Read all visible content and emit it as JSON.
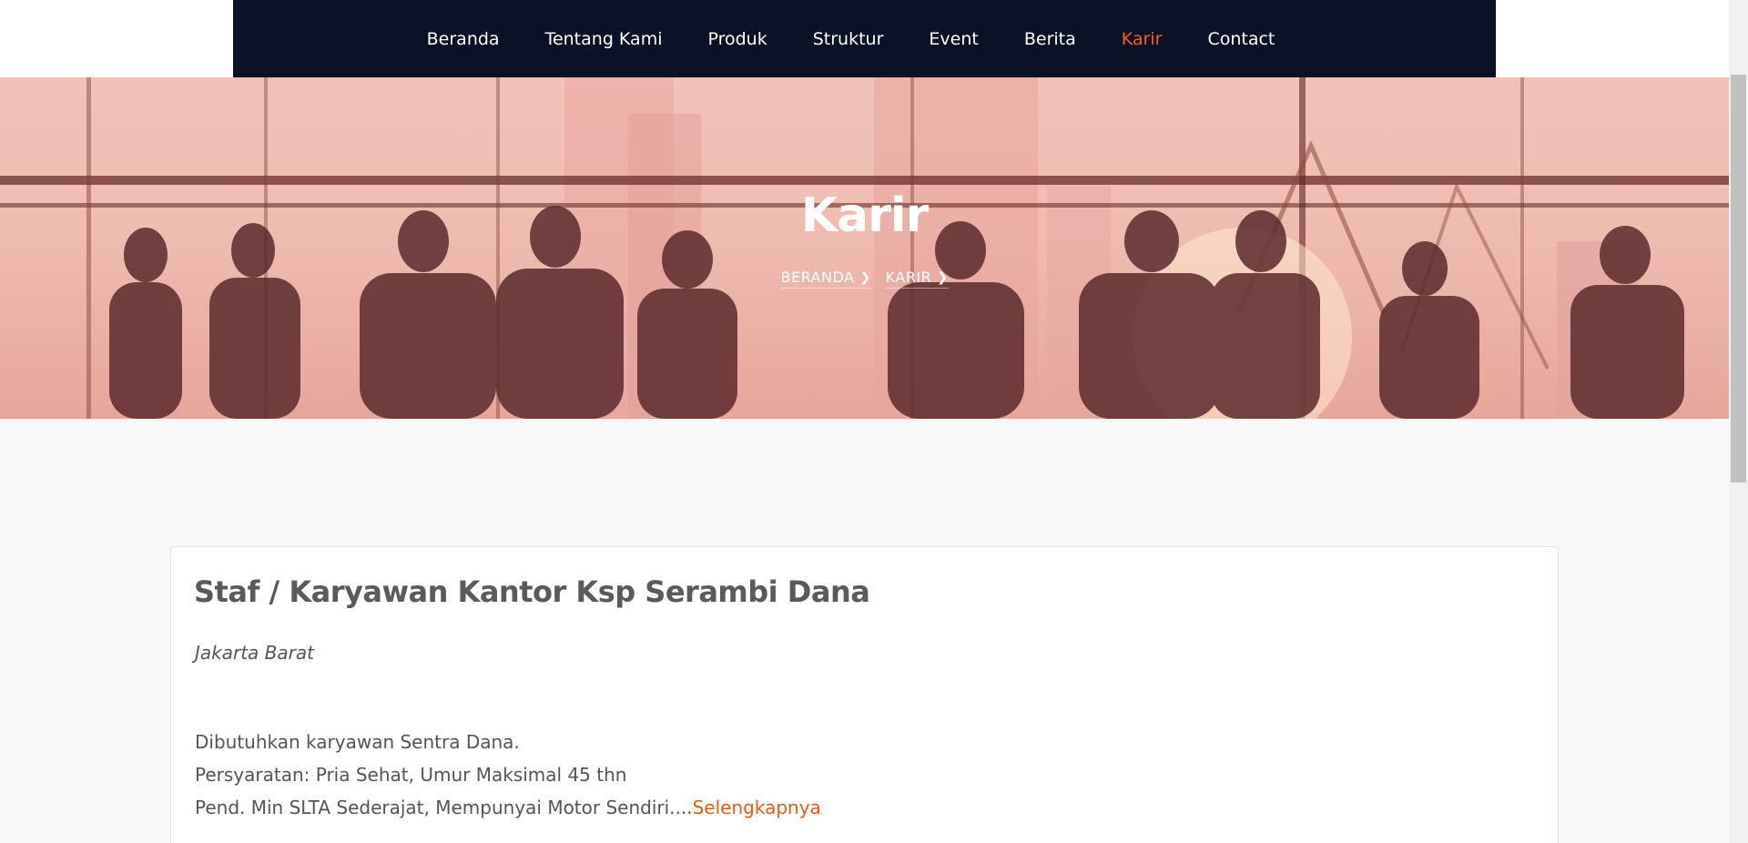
{
  "nav": {
    "items": [
      {
        "label": "Beranda",
        "active": false
      },
      {
        "label": "Tentang Kami",
        "active": false
      },
      {
        "label": "Produk",
        "active": false
      },
      {
        "label": "Struktur",
        "active": false
      },
      {
        "label": "Event",
        "active": false
      },
      {
        "label": "Berita",
        "active": false
      },
      {
        "label": "Karir",
        "active": true
      },
      {
        "label": "Contact",
        "active": false
      }
    ]
  },
  "hero": {
    "title": "Karir",
    "breadcrumb": [
      "BERANDA",
      "KARIR"
    ]
  },
  "job": {
    "title": "Staf / Karyawan Kantor Ksp Serambi Dana",
    "location": "Jakarta Barat",
    "desc_line1": "Dibutuhkan karyawan Sentra Dana.",
    "desc_line2": "Persyaratan: Pria Sehat, Umur Maksimal 45 thn",
    "desc_line3": "Pend. Min SLTA Sederajat, Mempunyai Motor Sendiri....",
    "more_label": "Selengkapnya"
  },
  "colors": {
    "nav_bg": "#0b1227",
    "active_nav": "#ff5a2a",
    "link": "#ea5a18",
    "hero_tint": "#f2c2b6"
  },
  "icons": {
    "breadcrumb_separator": "chevron-right-icon"
  }
}
